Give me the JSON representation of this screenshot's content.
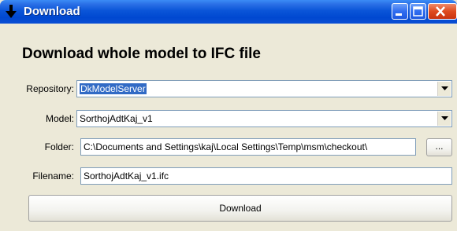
{
  "window": {
    "title": "Download",
    "icon": "download-arrow-icon",
    "controls": [
      "minimize-icon",
      "maximize-icon",
      "close-icon"
    ]
  },
  "heading": "Download whole model to IFC file",
  "repository": {
    "label": "Repository:",
    "value": "DkModelServer"
  },
  "model": {
    "label": "Model:",
    "value": "SorthojAdtKaj_v1"
  },
  "folder": {
    "label": "Folder:",
    "value": "C:\\Documents and Settings\\kaj\\Local Settings\\Temp\\msm\\checkout\\",
    "browse_label": "..."
  },
  "filename": {
    "label": "Filename:",
    "value": "SorthojAdtKaj_v1.ifc"
  },
  "download_button": "Download",
  "colors": {
    "titlebar": "#0a55d8",
    "selection": "#316ac5",
    "background": "#ece9d8"
  }
}
